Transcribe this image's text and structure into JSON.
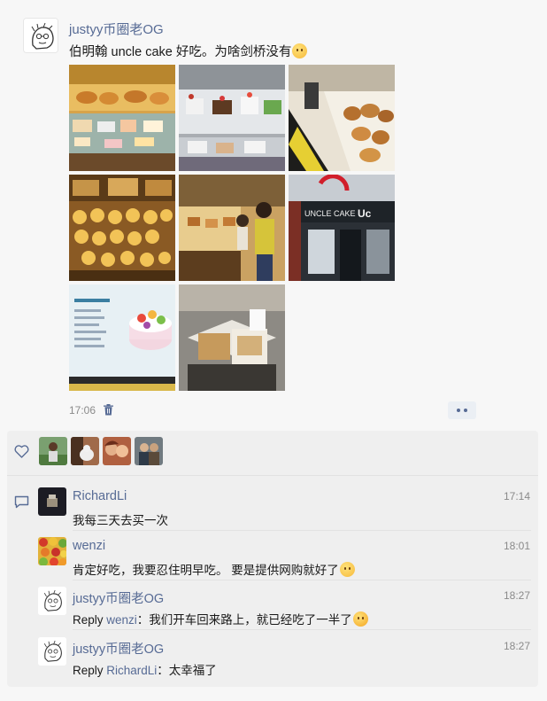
{
  "post": {
    "author": "justyy币圈老OG",
    "text": "伯明翰 uncle cake 好吃。为啥剑桥没有",
    "time": "17:06",
    "photos": [
      {
        "icon": "bakery-photo-1"
      },
      {
        "icon": "cake-display-photo"
      },
      {
        "icon": "pastry-shelf-photo"
      },
      {
        "icon": "tart-tray-photo"
      },
      {
        "icon": "shop-interior-photo"
      },
      {
        "icon": "storefront-photo"
      },
      {
        "icon": "cake-screen-photo"
      },
      {
        "icon": "cake-box-photo"
      }
    ],
    "storefront_sign": "UNCLE CAKE"
  },
  "likes": {
    "count_avatars": 4,
    "avatar_colors": [
      "#7aa070",
      "#a06a4a",
      "#b06040",
      "#707a80"
    ]
  },
  "comments": [
    {
      "name": "RichardLi",
      "time": "17:14",
      "prefix": "",
      "reply_to": "",
      "sep": "",
      "body": "我每三天去买一次",
      "emoji": ""
    },
    {
      "name": "wenzi",
      "time": "18:01",
      "prefix": "",
      "reply_to": "",
      "sep": "",
      "body": "肯定好吃，我要忍住明早吃。 要是提供网购就好了",
      "emoji": "cry"
    },
    {
      "name": "justyy币圈老OG",
      "time": "18:27",
      "prefix": "Reply ",
      "reply_to": "wenzi",
      "sep": "：",
      "body": "我们开车回来路上，就已经吃了一半了",
      "emoji": "laugh"
    },
    {
      "name": "justyy币圈老OG",
      "time": "18:27",
      "prefix": "Reply ",
      "reply_to": "RichardLi",
      "sep": "：",
      "body": "太幸福了",
      "emoji": ""
    }
  ],
  "colors": {
    "link": "#576b95",
    "panel": "#efefef",
    "bg": "#f7f7f7"
  }
}
